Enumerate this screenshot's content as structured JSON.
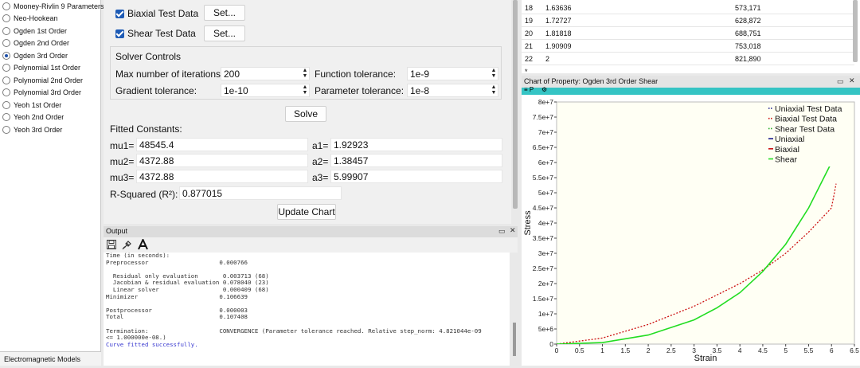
{
  "models": [
    {
      "label": "Mooney-Rivlin 9 Parameters",
      "selected": false
    },
    {
      "label": "Neo-Hookean",
      "selected": false
    },
    {
      "label": "Ogden 1st Order",
      "selected": false
    },
    {
      "label": "Ogden 2nd Order",
      "selected": false
    },
    {
      "label": "Ogden 3rd Order",
      "selected": true
    },
    {
      "label": "Polynomial 1st Order",
      "selected": false
    },
    {
      "label": "Polynomial 2nd Order",
      "selected": false
    },
    {
      "label": "Polynomial 3rd Order",
      "selected": false
    },
    {
      "label": "Yeoh 1st Order",
      "selected": false
    },
    {
      "label": "Yeoh 2nd Order",
      "selected": false
    },
    {
      "label": "Yeoh 3rd Order",
      "selected": false
    }
  ],
  "category_label": "Electromagnetic Models",
  "test_data": {
    "biaxial_label": "Biaxial Test Data",
    "shear_label": "Shear Test Data",
    "set_label": "Set..."
  },
  "solver": {
    "title": "Solver Controls",
    "max_iter_label": "Max number of iterations:",
    "max_iter_value": "200",
    "func_tol_label": "Function tolerance:",
    "func_tol_value": "1e-9",
    "grad_tol_label": "Gradient tolerance:",
    "grad_tol_value": "1e-10",
    "param_tol_label": "Parameter tolerance:",
    "param_tol_value": "1e-8",
    "solve_label": "Solve"
  },
  "fitted": {
    "title": "Fitted Constants:",
    "mu1_label": "mu1=",
    "mu1": "48545.4",
    "a1_label": "a1=",
    "a1": "1.92923",
    "mu2_label": "mu2=",
    "mu2": "4372.88",
    "a2_label": "a2=",
    "a2": "1.38457",
    "mu3_label": "mu3=",
    "mu3": "4372.88",
    "a3_label": "a3=",
    "a3": "5.99907",
    "r2_label": "R-Squared (R²):",
    "r2": "0.877015",
    "update_label": "Update Chart"
  },
  "output": {
    "title": "Output",
    "lines": [
      "Time (in seconds):",
      "Preprocessor                    0.000766",
      "",
      "  Residual only evaluation       0.003713 (68)",
      "  Jacobian & residual evaluation 0.078040 (23)",
      "  Linear solver                  0.000409 (68)",
      "Minimizer                       0.106639",
      "",
      "Postprocessor                   0.000003",
      "Total                           0.107408",
      "",
      "Termination:                    CONVERGENCE (Parameter tolerance reached. Relative step_norm: 4.821044e-09",
      "<= 1.000000e-08.)"
    ],
    "success_line": "Curve fitted successfully."
  },
  "table": {
    "rows": [
      {
        "idx": "18",
        "strain": "1.63636",
        "stress": "573,171"
      },
      {
        "idx": "19",
        "strain": "1.72727",
        "stress": "628,872"
      },
      {
        "idx": "20",
        "strain": "1.81818",
        "stress": "688,751"
      },
      {
        "idx": "21",
        "strain": "1.90909",
        "stress": "753,018"
      },
      {
        "idx": "22",
        "strain": "2",
        "stress": "821,890"
      },
      {
        "idx": "*",
        "strain": "",
        "stress": ""
      }
    ]
  },
  "chart_header": "Chart of Property: Ogden 3rd Order Shear",
  "chart_data": {
    "type": "line",
    "xlabel": "Strain",
    "ylabel": "Stress",
    "xlim": [
      0,
      6.5
    ],
    "ylim": [
      0,
      80000000
    ],
    "x_ticks": [
      "0",
      "0.5",
      "1",
      "1.5",
      "2",
      "2.5",
      "3",
      "3.5",
      "4",
      "4.5",
      "5",
      "5.5",
      "6",
      "6.5"
    ],
    "y_ticks": [
      "0",
      "5e+6",
      "1e+7",
      "1.5e+7",
      "2e+7",
      "2.5e+7",
      "3e+7",
      "3.5e+7",
      "4e+7",
      "4.5e+7",
      "5e+7",
      "5.5e+7",
      "6e+7",
      "6.5e+7",
      "7e+7",
      "7.5e+7",
      "8e+7"
    ],
    "legend": [
      "Uniaxial Test Data",
      "Biaxial Test Data",
      "Shear Test Data",
      "Uniaxial",
      "Biaxial",
      "Shear"
    ],
    "legend_colors": [
      "#1a1a8c",
      "#cc1111",
      "#22aa22",
      "#1a1a8c",
      "#cc1111",
      "#22dd22"
    ],
    "legend_dashed": [
      true,
      true,
      true,
      false,
      false,
      false
    ],
    "series": [
      {
        "name": "Biaxial Test Data",
        "color": "#cc1111",
        "dashed": true,
        "x": [
          0,
          1,
          2,
          3,
          4,
          4.5,
          5,
          5.5,
          6,
          6.1
        ],
        "y": [
          0,
          2000000,
          6500000,
          12500000,
          20000000,
          24500000,
          30000000,
          37000000,
          45000000,
          53000000
        ]
      },
      {
        "name": "Shear",
        "color": "#22dd22",
        "dashed": false,
        "x": [
          0,
          1,
          2,
          3,
          3.5,
          4,
          4.5,
          5,
          5.5,
          6
        ],
        "y": [
          0,
          500000,
          3000000,
          8000000,
          12000000,
          17000000,
          24000000,
          33000000,
          45000000,
          60000000
        ]
      }
    ]
  }
}
